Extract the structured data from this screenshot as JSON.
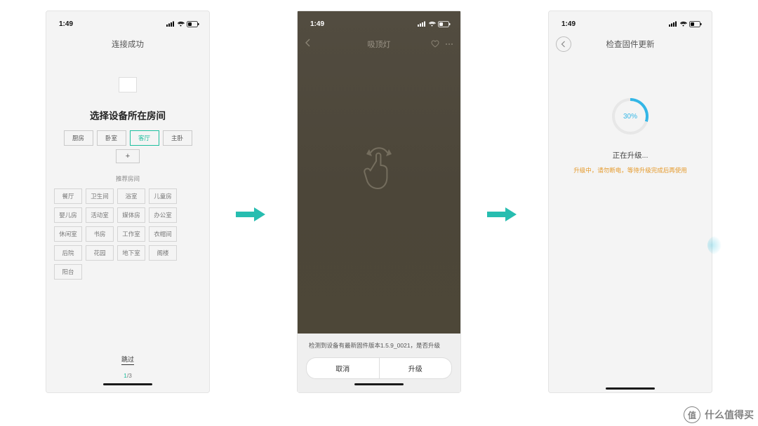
{
  "status": {
    "time": "1:49"
  },
  "screen1": {
    "navTitle": "连接成功",
    "heading": "选择设备所在房间",
    "primaryTags": [
      "厨房",
      "卧室",
      "客厅",
      "主卧"
    ],
    "selectedIndex": 2,
    "recommendLabel": "推荐房间",
    "chips": [
      "餐厅",
      "卫生间",
      "浴室",
      "儿童房",
      "婴儿房",
      "活动室",
      "媒体房",
      "办公室",
      "休闲室",
      "书房",
      "工作室",
      "衣帽间",
      "后院",
      "花园",
      "地下室",
      "阁楼",
      "阳台"
    ],
    "skip": "跳过",
    "pageCurrent": "1",
    "pageTotal": "/3"
  },
  "screen2": {
    "navTitle": "吸顶灯",
    "message": "检测到设备有最新固件版本1.5.9_0021，是否升级",
    "cancel": "取消",
    "confirm": "升级"
  },
  "screen3": {
    "navTitle": "检查固件更新",
    "percent": "30%",
    "status": "正在升级...",
    "warning": "升级中，请勿断电，等待升级完成后再使用"
  },
  "watermark": {
    "badge": "值",
    "text": "什么值得买"
  }
}
